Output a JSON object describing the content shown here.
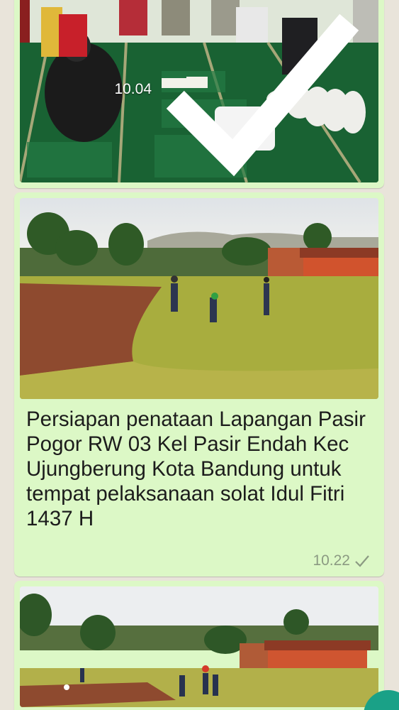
{
  "messages": [
    {
      "type": "image",
      "description_icon": "photo",
      "time": "10.04",
      "status_icon": "check-icon"
    },
    {
      "type": "image-with-caption",
      "caption": "Persiapan penataan Lapangan Pasir Pogor RW 03 Kel Pasir Endah Kec Ujungberung Kota Bandung untuk tempat pelaksanaan solat Idul Fitri 1437 H",
      "time": "10.22",
      "status_icon": "check-icon"
    },
    {
      "type": "image",
      "time": "",
      "status_icon": ""
    }
  ],
  "colors": {
    "bubble": "#dcf8c6",
    "wallpaper": "#e9e4da",
    "fab": "#1aa187"
  }
}
